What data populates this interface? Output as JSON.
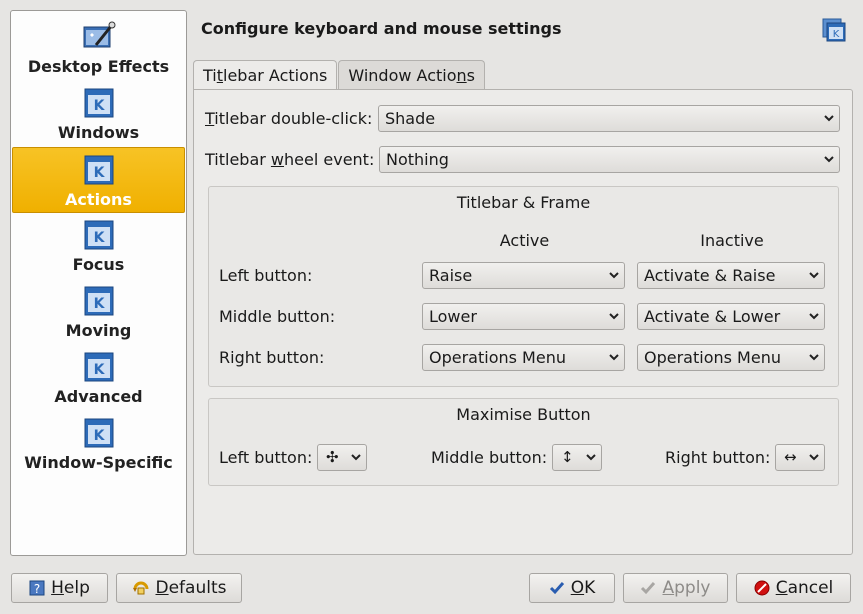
{
  "sidebar": {
    "items": [
      {
        "label": "Desktop Effects",
        "icon": "desktop-effects-icon",
        "active": false
      },
      {
        "label": "Windows",
        "icon": "window-icon",
        "active": false
      },
      {
        "label": "Actions",
        "icon": "window-icon",
        "active": true
      },
      {
        "label": "Focus",
        "icon": "window-icon",
        "active": false
      },
      {
        "label": "Moving",
        "icon": "window-icon",
        "active": false
      },
      {
        "label": "Advanced",
        "icon": "window-icon",
        "active": false
      },
      {
        "label": "Window-Specific",
        "icon": "window-icon",
        "active": false
      }
    ]
  },
  "header": {
    "title": "Configure keyboard and mouse settings"
  },
  "tabs": [
    {
      "label_pre": "Ti",
      "label_u": "t",
      "label_post": "lebar Actions",
      "active": true
    },
    {
      "label_pre": "Window Actio",
      "label_u": "n",
      "label_post": "s",
      "active": false
    }
  ],
  "titlebar": {
    "dbl_click_label_u": "T",
    "dbl_click_label_post": "itlebar double-click:",
    "dbl_click_value": "Shade",
    "wheel_label_pre": "Titlebar ",
    "wheel_label_u": "w",
    "wheel_label_post": "heel event:",
    "wheel_value": "Nothing"
  },
  "frame_group": {
    "title": "Titlebar & Frame",
    "col_active": "Active",
    "col_inactive": "Inactive",
    "rows": [
      {
        "label": "Left button:",
        "active": "Raise",
        "inactive": "Activate & Raise"
      },
      {
        "label": "Middle button:",
        "active": "Lower",
        "inactive": "Activate & Lower"
      },
      {
        "label": "Right button:",
        "active": "Operations Menu",
        "inactive": "Operations Menu"
      }
    ]
  },
  "maximise_group": {
    "title": "Maximise Button",
    "left_label": "Left button:",
    "left_value": "✣",
    "middle_label": "Middle button:",
    "middle_value": "↕",
    "right_label": "Right button:",
    "right_value": "↔"
  },
  "buttons": {
    "help_u": "H",
    "help_post": "elp",
    "defaults_u": "D",
    "defaults_post": "efaults",
    "ok_pre": "",
    "ok_u": "O",
    "ok_post": "K",
    "apply_u": "A",
    "apply_post": "pply",
    "cancel_u": "C",
    "cancel_post": "ancel"
  },
  "colors": {
    "active_item": "#f0b000",
    "cancel_icon": "#d01010",
    "ok_icon": "#2a5db0"
  }
}
